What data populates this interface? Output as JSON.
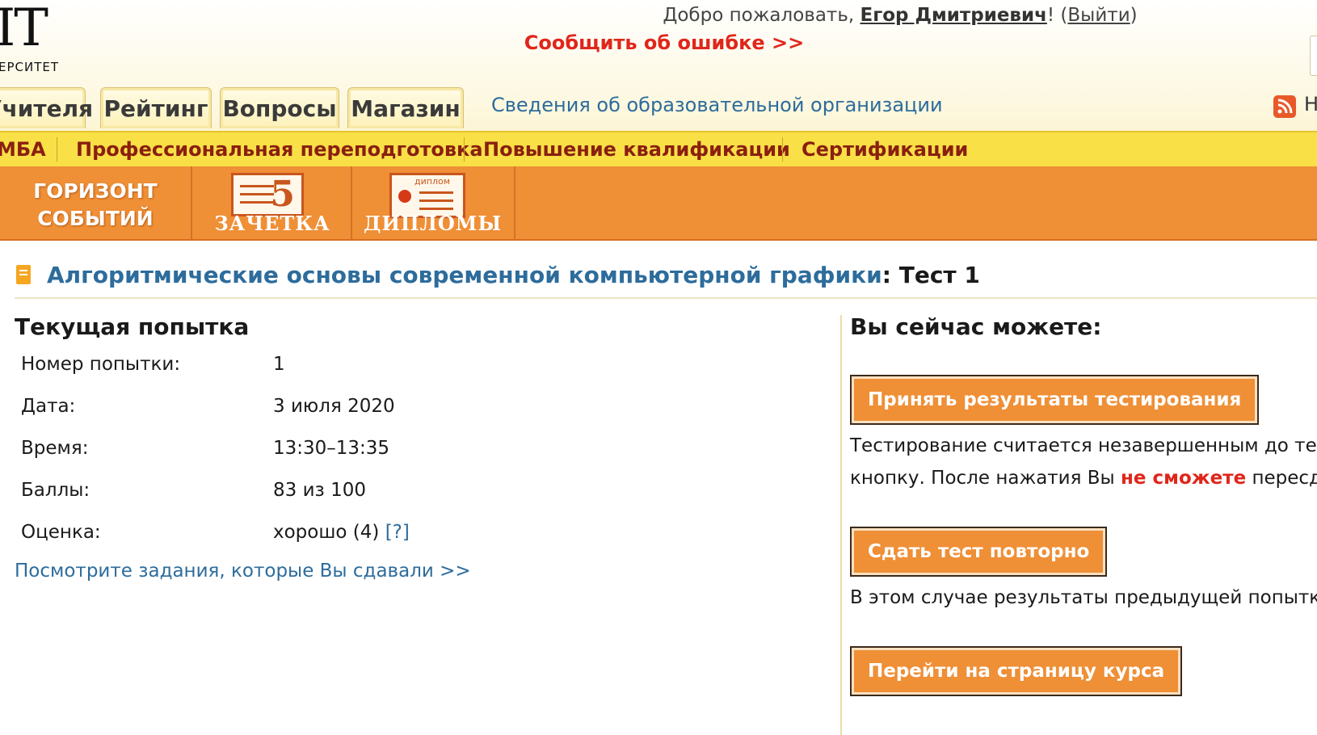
{
  "header": {
    "logo_big": "IT",
    "logo_small": "ЕРСИТЕТ",
    "welcome_prefix": "Добро пожаловать, ",
    "user_name": "Егор Дмитриевич",
    "welcome_mid": "! (",
    "logout": "Выйти",
    "welcome_end": ")",
    "report_error": "Сообщить об ошибке >>"
  },
  "tabs": [
    "Учителя",
    "Рейтинг",
    "Вопросы",
    "Магазин"
  ],
  "org_link": "Сведения об образовательной организации",
  "rss_tail": "Н",
  "yellow_nav": [
    "МБА",
    "Профессиональная переподготовка",
    "Повышение квалификации",
    "Сертификации"
  ],
  "orange_nav": {
    "horizon_line1": "ГОРИЗОНТ",
    "horizon_line2": "СОБЫТИЙ",
    "zachetka": "ЗАЧЕТКА",
    "zachetka_mark": "5",
    "diplomy": "ДИПЛОМЫ",
    "diplom_icon_text": "диплом"
  },
  "page": {
    "course": "Алгоритмические основы современной компьютерной графики",
    "sep": ": ",
    "test": "Тест 1"
  },
  "attempt": {
    "heading": "Текущая попытка",
    "rows": [
      {
        "label": "Номер попытки:",
        "value": "1"
      },
      {
        "label": "Дата:",
        "value": "3 июля 2020"
      },
      {
        "label": "Время:",
        "value": "13:30–13:35"
      },
      {
        "label": "Баллы:",
        "value": "83 из 100"
      },
      {
        "label": "Оценка:",
        "value": "хорошо (4)"
      }
    ],
    "grade_hint": "[?]",
    "view_link": "Посмотрите задания, которые Вы сдавали >>"
  },
  "actions": {
    "heading": "Вы сейчас можете:",
    "accept_btn": "Принять результаты тестирования",
    "accept_text1": "Тестирование считается незавершенным до тех",
    "accept_text2_a": "кнопку. После нажатия Вы ",
    "accept_text2_red": "не сможете",
    "accept_text2_b": " пересдав",
    "retake_btn": "Сдать тест повторно",
    "retake_text": "В этом случае результаты предыдущей попытки",
    "course_btn": "Перейти на страницу курса"
  }
}
